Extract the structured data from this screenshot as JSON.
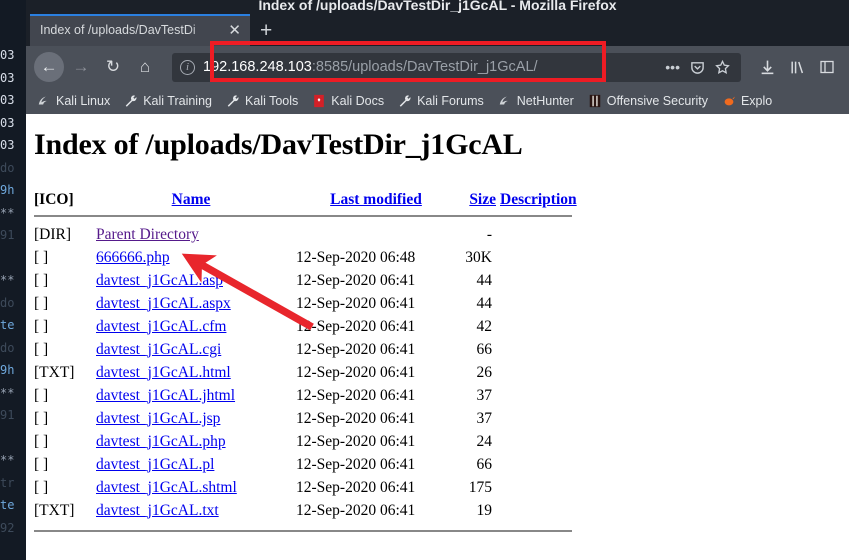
{
  "window": {
    "title": "Index of /uploads/DavTestDir_j1GcAL - Mozilla Firefox"
  },
  "tabs": {
    "active": {
      "label": "Index of /uploads/DavTestDi",
      "close_glyph": "✕"
    },
    "new_tab_glyph": "+"
  },
  "toolbar": {
    "back_glyph": "←",
    "forward_glyph": "→",
    "reload_glyph": "↻",
    "home_glyph": "⌂",
    "menu_glyph": "•••",
    "info_glyph": "i",
    "url_host": "192.168.248.103",
    "url_path": ":8585/uploads/DavTestDir_j1GcAL/",
    "highlight_color": "#ee1c24"
  },
  "bookmarks": [
    {
      "label": "Kali Linux",
      "icon": "kali-dragon-icon"
    },
    {
      "label": "Kali Training",
      "icon": "wrench-icon"
    },
    {
      "label": "Kali Tools",
      "icon": "wrench-icon"
    },
    {
      "label": "Kali Docs",
      "icon": "red-book-icon"
    },
    {
      "label": "Kali Forums",
      "icon": "wrench-icon"
    },
    {
      "label": "NetHunter",
      "icon": "kali-dragon-icon"
    },
    {
      "label": "Offensive Security",
      "icon": "offsec-icon"
    },
    {
      "label": "Explo",
      "icon": "exploitdb-icon"
    }
  ],
  "page": {
    "heading": "Index of /uploads/DavTestDir_j1GcAL",
    "columns": {
      "icon": "[ICO]",
      "name": "Name",
      "last_modified": "Last modified",
      "size": "Size",
      "description": "Description"
    },
    "rows": [
      {
        "icon": "[DIR]",
        "name": "Parent Directory",
        "modified": "",
        "size": "-",
        "desc": "",
        "visited": true
      },
      {
        "icon": "[ ]",
        "name": "666666.php",
        "modified": "12-Sep-2020 06:48",
        "size": "30K",
        "desc": ""
      },
      {
        "icon": "[ ]",
        "name": "davtest_j1GcAL.asp",
        "modified": "12-Sep-2020 06:41",
        "size": "44",
        "desc": ""
      },
      {
        "icon": "[ ]",
        "name": "davtest_j1GcAL.aspx",
        "modified": "12-Sep-2020 06:41",
        "size": "44",
        "desc": ""
      },
      {
        "icon": "[ ]",
        "name": "davtest_j1GcAL.cfm",
        "modified": "12-Sep-2020 06:41",
        "size": "42",
        "desc": ""
      },
      {
        "icon": "[ ]",
        "name": "davtest_j1GcAL.cgi",
        "modified": "12-Sep-2020 06:41",
        "size": "66",
        "desc": ""
      },
      {
        "icon": "[TXT]",
        "name": "davtest_j1GcAL.html",
        "modified": "12-Sep-2020 06:41",
        "size": "26",
        "desc": ""
      },
      {
        "icon": "[ ]",
        "name": "davtest_j1GcAL.jhtml",
        "modified": "12-Sep-2020 06:41",
        "size": "37",
        "desc": ""
      },
      {
        "icon": "[ ]",
        "name": "davtest_j1GcAL.jsp",
        "modified": "12-Sep-2020 06:41",
        "size": "37",
        "desc": ""
      },
      {
        "icon": "[ ]",
        "name": "davtest_j1GcAL.php",
        "modified": "12-Sep-2020 06:41",
        "size": "24",
        "desc": ""
      },
      {
        "icon": "[ ]",
        "name": "davtest_j1GcAL.pl",
        "modified": "12-Sep-2020 06:41",
        "size": "66",
        "desc": ""
      },
      {
        "icon": "[ ]",
        "name": "davtest_j1GcAL.shtml",
        "modified": "12-Sep-2020 06:41",
        "size": "175",
        "desc": ""
      },
      {
        "icon": "[TXT]",
        "name": "davtest_j1GcAL.txt",
        "modified": "12-Sep-2020 06:41",
        "size": "19",
        "desc": ""
      }
    ]
  },
  "terminal_background": {
    "lines": [
      "03",
      "03",
      "03",
      "03",
      "03",
      "do",
      "9h",
      "**",
      "91",
      "",
      "**",
      "do",
      "te",
      "do",
      "9h",
      "**",
      "91",
      "",
      "**",
      "tr",
      "te",
      "92"
    ]
  }
}
